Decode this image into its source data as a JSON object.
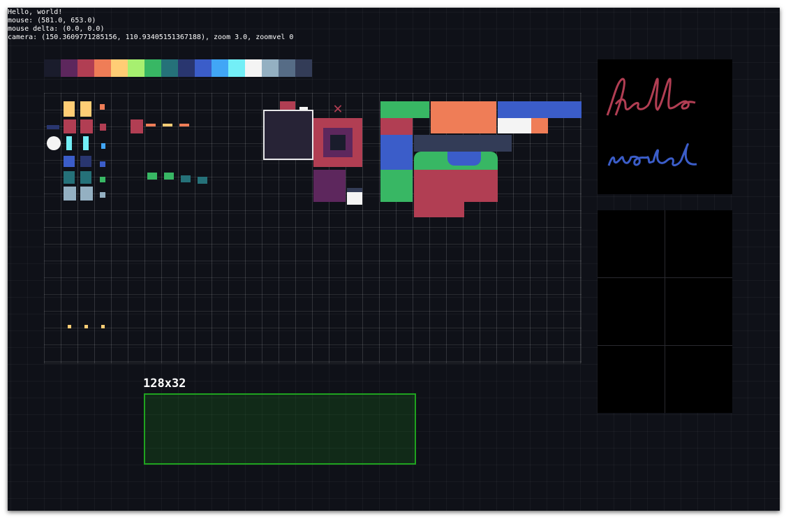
{
  "debug": {
    "line1": "Hello, world!",
    "line2": "mouse: (581.0, 653.0)",
    "line3": "mouse delta: (0.0, 0.0)",
    "line4": "camera: (150.3609771285156, 110.93405151367188), zoom 3.0, zoomvel 0"
  },
  "palette": [
    "#1a1c2c",
    "#5d275d",
    "#b13e53",
    "#ef7d57",
    "#ffcd75",
    "#a7f070",
    "#38b764",
    "#257179",
    "#29366f",
    "#3b5dc9",
    "#41a6f6",
    "#73eff7",
    "#f4f4f4",
    "#94b0c2",
    "#566c86",
    "#333c57"
  ],
  "hello_panel": {
    "word1": "hello",
    "word2": "world",
    "word1_color": "#b13e53",
    "word2_color": "#3b5dc9"
  },
  "rect": {
    "label": "128x32",
    "border_color": "#1fa31f"
  },
  "icons": {
    "close": "x-icon"
  }
}
